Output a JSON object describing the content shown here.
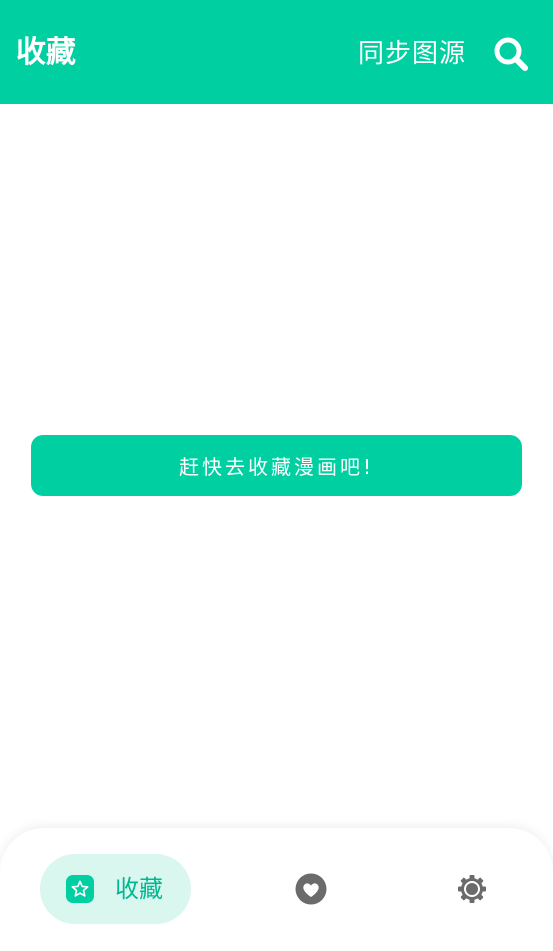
{
  "header": {
    "title": "收藏",
    "sync_label": "同步图源",
    "search_icon": "search-icon"
  },
  "empty_state": {
    "button_label": "赶快去收藏漫画吧!"
  },
  "bottom_nav": {
    "items": [
      {
        "label": "收藏",
        "icon": "star-icon",
        "active": true
      },
      {
        "label": "",
        "icon": "heart-icon",
        "active": false
      },
      {
        "label": "",
        "icon": "gear-icon",
        "active": false
      }
    ]
  },
  "colors": {
    "accent": "#00cfa2",
    "nav_active_bg": "#d9f6ef",
    "icon_gray": "#6b6b6b"
  }
}
